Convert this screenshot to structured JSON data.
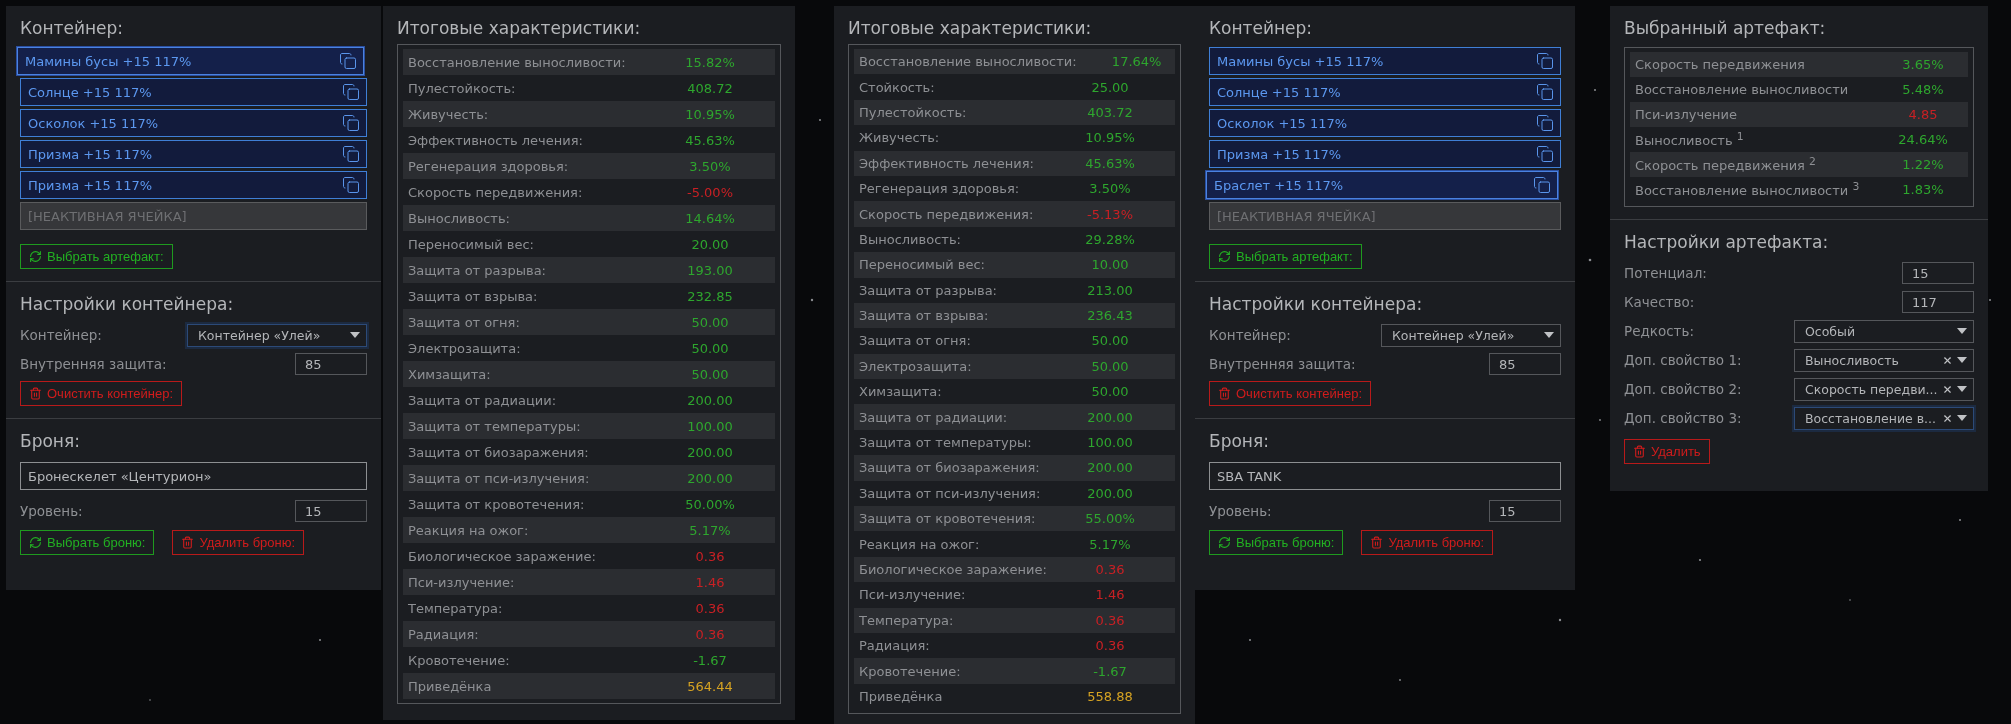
{
  "panels": [
    {
      "kind": "container",
      "title": "Контейнер:",
      "slots": [
        {
          "kind": "artifact",
          "label": "Мамины бусы +15 117%",
          "selected": true
        },
        {
          "kind": "artifact",
          "label": "Солнце +15 117%",
          "selected": false
        },
        {
          "kind": "artifact",
          "label": "Осколок +15 117%",
          "selected": false
        },
        {
          "kind": "artifact",
          "label": "Призма +15 117%",
          "selected": false
        },
        {
          "kind": "artifact",
          "label": "Призма +15 117%",
          "selected": false
        },
        {
          "kind": "inactive",
          "label": "[НЕАКТИВНАЯ ЯЧЕЙКА]",
          "selected": false
        }
      ],
      "pick_button": "Выбрать артефакт:",
      "settings_title": "Настройки контейнера:",
      "container_label": "Контейнер:",
      "container_value": "Контейнер «Улей»",
      "container_focused": true,
      "protection_label": "Внутренняя защита:",
      "protection_value": "85",
      "clear_button": "Очистить контейнер:",
      "armor_title": "Броня:",
      "armor_name": "Бронескелет «Центурион»",
      "level_label": "Уровень:",
      "level_value": "15",
      "pick_armor_button": "Выбрать броню:",
      "delete_armor_button": "Удалить броню:"
    },
    {
      "kind": "stats",
      "title": "Итоговые характеристики:",
      "rows": [
        {
          "label": "Восстановление выносливости:",
          "value": "15.82%",
          "kind": "positive"
        },
        {
          "label": "Пулестойкость:",
          "value": "408.72",
          "kind": "positive"
        },
        {
          "label": "Живучесть:",
          "value": "10.95%",
          "kind": "positive"
        },
        {
          "label": "Эффективность лечения:",
          "value": "45.63%",
          "kind": "positive"
        },
        {
          "label": "Регенерация здоровья:",
          "value": "3.50%",
          "kind": "positive"
        },
        {
          "label": "Скорость передвижения:",
          "value": "-5.00%",
          "kind": "negative"
        },
        {
          "label": "Выносливость:",
          "value": "14.64%",
          "kind": "positive"
        },
        {
          "label": "Переносимый вес:",
          "value": "20.00",
          "kind": "positive"
        },
        {
          "label": "Защита от разрыва:",
          "value": "193.00",
          "kind": "positive"
        },
        {
          "label": "Защита от взрыва:",
          "value": "232.85",
          "kind": "positive"
        },
        {
          "label": "Защита от огня:",
          "value": "50.00",
          "kind": "positive"
        },
        {
          "label": "Электрозащита:",
          "value": "50.00",
          "kind": "positive"
        },
        {
          "label": "Химзащита:",
          "value": "50.00",
          "kind": "positive"
        },
        {
          "label": "Защита от радиации:",
          "value": "200.00",
          "kind": "positive"
        },
        {
          "label": "Защита от температуры:",
          "value": "100.00",
          "kind": "positive"
        },
        {
          "label": "Защита от биозаражения:",
          "value": "200.00",
          "kind": "positive"
        },
        {
          "label": "Защита от пси-излучения:",
          "value": "200.00",
          "kind": "positive"
        },
        {
          "label": "Защита от кровотечения:",
          "value": "50.00%",
          "kind": "positive"
        },
        {
          "label": "Реакция на ожог:",
          "value": "5.17%",
          "kind": "positive"
        },
        {
          "label": "Биологическое заражение:",
          "value": "0.36",
          "kind": "negative"
        },
        {
          "label": "Пси-излучение:",
          "value": "1.46",
          "kind": "negative"
        },
        {
          "label": "Температура:",
          "value": "0.36",
          "kind": "negative"
        },
        {
          "label": "Радиация:",
          "value": "0.36",
          "kind": "negative"
        },
        {
          "label": "Кровотечение:",
          "value": "-1.67",
          "kind": "positive"
        },
        {
          "label": "Приведёнка",
          "value": "564.44",
          "kind": "total"
        }
      ]
    },
    {
      "kind": "stats",
      "title": "Итоговые характеристики:",
      "rows": [
        {
          "label": "Восстановление выносливости:",
          "value": "17.64%",
          "kind": "positive"
        },
        {
          "label": "Стойкость:",
          "value": "25.00",
          "kind": "positive"
        },
        {
          "label": "Пулестойкость:",
          "value": "403.72",
          "kind": "positive"
        },
        {
          "label": "Живучесть:",
          "value": "10.95%",
          "kind": "positive"
        },
        {
          "label": "Эффективность лечения:",
          "value": "45.63%",
          "kind": "positive"
        },
        {
          "label": "Регенерация здоровья:",
          "value": "3.50%",
          "kind": "positive"
        },
        {
          "label": "Скорость передвижения:",
          "value": "-5.13%",
          "kind": "negative"
        },
        {
          "label": "Выносливость:",
          "value": "29.28%",
          "kind": "positive"
        },
        {
          "label": "Переносимый вес:",
          "value": "10.00",
          "kind": "positive"
        },
        {
          "label": "Защита от разрыва:",
          "value": "213.00",
          "kind": "positive"
        },
        {
          "label": "Защита от взрыва:",
          "value": "236.43",
          "kind": "positive"
        },
        {
          "label": "Защита от огня:",
          "value": "50.00",
          "kind": "positive"
        },
        {
          "label": "Электрозащита:",
          "value": "50.00",
          "kind": "positive"
        },
        {
          "label": "Химзащита:",
          "value": "50.00",
          "kind": "positive"
        },
        {
          "label": "Защита от радиации:",
          "value": "200.00",
          "kind": "positive"
        },
        {
          "label": "Защита от температуры:",
          "value": "100.00",
          "kind": "positive"
        },
        {
          "label": "Защита от биозаражения:",
          "value": "200.00",
          "kind": "positive"
        },
        {
          "label": "Защита от пси-излучения:",
          "value": "200.00",
          "kind": "positive"
        },
        {
          "label": "Защита от кровотечения:",
          "value": "55.00%",
          "kind": "positive"
        },
        {
          "label": "Реакция на ожог:",
          "value": "5.17%",
          "kind": "positive"
        },
        {
          "label": "Биологическое заражение:",
          "value": "0.36",
          "kind": "negative"
        },
        {
          "label": "Пси-излучение:",
          "value": "1.46",
          "kind": "negative"
        },
        {
          "label": "Температура:",
          "value": "0.36",
          "kind": "negative"
        },
        {
          "label": "Радиация:",
          "value": "0.36",
          "kind": "negative"
        },
        {
          "label": "Кровотечение:",
          "value": "-1.67",
          "kind": "positive"
        },
        {
          "label": "Приведёнка",
          "value": "558.88",
          "kind": "total"
        }
      ]
    },
    {
      "kind": "container",
      "title": "Контейнер:",
      "slots": [
        {
          "kind": "artifact",
          "label": "Мамины бусы +15 117%",
          "selected": false
        },
        {
          "kind": "artifact",
          "label": "Солнце +15 117%",
          "selected": false
        },
        {
          "kind": "artifact",
          "label": "Осколок +15 117%",
          "selected": false
        },
        {
          "kind": "artifact",
          "label": "Призма +15 117%",
          "selected": false
        },
        {
          "kind": "artifact",
          "label": "Браслет +15 117%",
          "selected": true
        },
        {
          "kind": "inactive",
          "label": "[НЕАКТИВНАЯ ЯЧЕЙКА]",
          "selected": false
        }
      ],
      "pick_button": "Выбрать артефакт:",
      "settings_title": "Настройки контейнера:",
      "container_label": "Контейнер:",
      "container_value": "Контейнер «Улей»",
      "container_focused": false,
      "protection_label": "Внутренняя защита:",
      "protection_value": "85",
      "clear_button": "Очистить контейнер:",
      "armor_title": "Броня:",
      "armor_name": "SBA TANK",
      "level_label": "Уровень:",
      "level_value": "15",
      "pick_armor_button": "Выбрать броню:",
      "delete_armor_button": "Удалить броню:"
    },
    {
      "kind": "artifact",
      "title": "Выбранный артефакт:",
      "properties": [
        {
          "label": "Скорость передвижения",
          "value": "3.65%",
          "kind": "positive"
        },
        {
          "label": "Восстановление выносливости",
          "value": "5.48%",
          "kind": "positive"
        },
        {
          "label": "Пси-излучение",
          "value": "4.85",
          "kind": "negative"
        },
        {
          "label": "Выносливость $^{1}$",
          "value": "24.64%",
          "kind": "positive"
        },
        {
          "label": "Скорость передвижения $^{2}$",
          "value": "1.22%",
          "kind": "positive"
        },
        {
          "label": "Восстановление выносливости $^{3}$",
          "value": "1.83%",
          "kind": "positive"
        }
      ],
      "settings_title": "Настройки артефакта:",
      "fields": [
        {
          "kind": "input",
          "label": "Потенциал:",
          "value": "15"
        },
        {
          "kind": "input",
          "label": "Качество:",
          "value": "117"
        },
        {
          "kind": "select",
          "label": "Редкость:",
          "value": "Особый",
          "clearable": false,
          "focused": false
        },
        {
          "kind": "select",
          "label": "Доп. свойство 1:",
          "value": "Выносливость",
          "clearable": true,
          "focused": false
        },
        {
          "kind": "select",
          "label": "Доп. свойство 2:",
          "value": "Скорость передви...",
          "clearable": true,
          "focused": false
        },
        {
          "kind": "select",
          "label": "Доп. свойство 3:",
          "value": "Восстановление в...",
          "clearable": true,
          "focused": true
        }
      ],
      "delete_button": "Удалить"
    }
  ]
}
